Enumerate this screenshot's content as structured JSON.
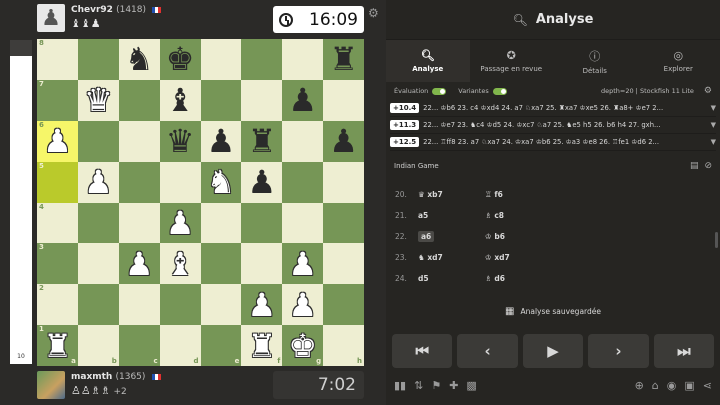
{
  "top_player": {
    "name": "Chevr92",
    "rating": "(1418)",
    "captured": "♝♝♟",
    "clock": "16:09"
  },
  "bottom_player": {
    "name": "maxmth",
    "rating": "(1365)",
    "captured": "♙♙♗♗",
    "captured_plus": "+2",
    "clock": "7:02"
  },
  "eval_bar": {
    "label": "10",
    "white_fraction": 0.95
  },
  "board": {
    "ranks": [
      "8",
      "7",
      "6",
      "5",
      "4",
      "3",
      "2",
      "1"
    ],
    "files": [
      "a",
      "b",
      "c",
      "d",
      "e",
      "f",
      "g",
      "h"
    ],
    "rows": [
      [
        "",
        "",
        "bn",
        "bk",
        "",
        "",
        "",
        "br"
      ],
      [
        "",
        "wq",
        "",
        "bb",
        "",
        "",
        "bp",
        ""
      ],
      [
        "wp",
        "",
        "",
        "bq",
        "bp",
        "br",
        "",
        "bp"
      ],
      [
        "",
        "wp",
        "",
        "",
        "wn",
        "bp",
        "",
        ""
      ],
      [
        "",
        "",
        "",
        "wp",
        "",
        "",
        "",
        ""
      ],
      [
        "",
        "",
        "wp",
        "wb",
        "",
        "",
        "wp",
        ""
      ],
      [
        "",
        "",
        "",
        "",
        "",
        "wp",
        "wp",
        ""
      ],
      [
        "wr",
        "",
        "",
        "",
        "",
        "wr",
        "wk",
        ""
      ]
    ],
    "highlights": [
      "a6",
      "a5"
    ]
  },
  "analysis": {
    "title": "Analyse",
    "tabs": [
      {
        "label": "Analyse",
        "icon": "magnifier-icon",
        "active": true
      },
      {
        "label": "Passage en revue",
        "icon": "star-icon",
        "active": false
      },
      {
        "label": "Détails",
        "icon": "info-icon",
        "active": false
      },
      {
        "label": "Explorer",
        "icon": "compass-icon",
        "active": false
      }
    ],
    "evaluation_label": "Évaluation",
    "variants_label": "Variantes",
    "depth": "depth=20 | Stockfish 11 Lite",
    "lines": [
      {
        "score": "+10.4",
        "moves": "22... ♔b6 23. c4 ♔xd4 24. a7 ♘xa7 25. ♜xa7 ♔xe5 26. ♜a8+ ♔e7 2..."
      },
      {
        "score": "+11.3",
        "moves": "22... ♔e7 23. ♞c4 ♔d5 24. ♔xc7 ♘a7 25. ♞e5 h5 26. b6 h4 27. gxh..."
      },
      {
        "score": "+12.5",
        "moves": "22... ♖ff8 23. a7 ♘xa7 24. ♔xa7 ♔b6 25. ♔a3 ♔e8 26. ♖fe1 ♔d6 2..."
      }
    ],
    "opening": "Indian Game",
    "moves": [
      {
        "num": "20.",
        "white": "♛ xb7",
        "black": "♖ f6"
      },
      {
        "num": "21.",
        "white": "a5",
        "black": "♗ c8"
      },
      {
        "num": "22.",
        "white": "a6",
        "black": "♔ b6"
      },
      {
        "num": "23.",
        "white": "♞ xd7",
        "black": "♔ xd7"
      },
      {
        "num": "24.",
        "white": "d5",
        "black": "♗ d6"
      }
    ],
    "saved_label": "Analyse sauvegardée",
    "nav": [
      "⏮",
      "‹",
      "▶",
      "›",
      "⏭"
    ]
  }
}
